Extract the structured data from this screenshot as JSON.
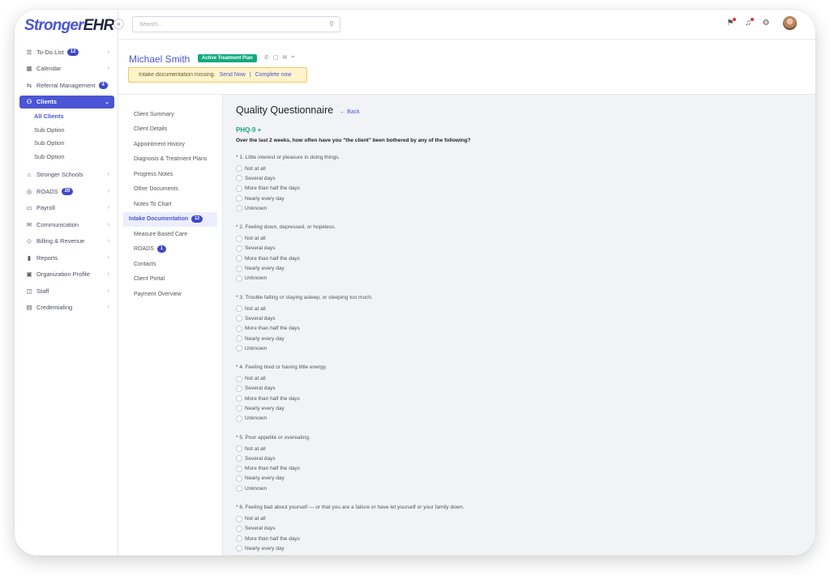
{
  "brand": {
    "part1": "Stronger",
    "part2": "EHR"
  },
  "sidebar": {
    "items": [
      {
        "label": "To-Do List",
        "badge": "12",
        "icon": "list-icon",
        "glyph": "☰"
      },
      {
        "label": "Calendar",
        "icon": "calendar-icon",
        "glyph": "▦"
      },
      {
        "label": "Referral Management",
        "badge": "4",
        "icon": "referral-icon",
        "glyph": "⇆"
      },
      {
        "label": "Clients",
        "icon": "users-icon",
        "glyph": "👥"
      },
      {
        "label": "Stronger Schools",
        "icon": "school-icon",
        "glyph": "⌂"
      },
      {
        "label": "ROADS",
        "badge": "20",
        "icon": "roads-icon",
        "glyph": "◎"
      },
      {
        "label": "Payroll",
        "icon": "payroll-icon",
        "glyph": "▭"
      },
      {
        "label": "Communication",
        "icon": "chat-icon",
        "glyph": "✉"
      },
      {
        "label": "Billing & Revenue",
        "icon": "tag-icon",
        "glyph": "◇"
      },
      {
        "label": "Reports",
        "icon": "chart-icon",
        "glyph": "▮"
      },
      {
        "label": "Organization Profile",
        "icon": "org-icon",
        "glyph": "▣"
      },
      {
        "label": "Staff",
        "icon": "staff-icon",
        "glyph": "◫"
      },
      {
        "label": "Credentialing",
        "icon": "id-card-icon",
        "glyph": "▤"
      }
    ],
    "sub_items": [
      "All Clients",
      "Sub Option",
      "Sub Option",
      "Sub Option"
    ]
  },
  "search": {
    "placeholder": "Search..."
  },
  "client": {
    "name": "Michael Smith",
    "status": "Active Treatment Plan",
    "alert_text": "Intake documentation missing.",
    "alert_send": "Send Now",
    "alert_sep": "|",
    "alert_complete": "Complete now"
  },
  "subnav": {
    "items": [
      {
        "label": "Client Summary"
      },
      {
        "label": "Client Details"
      },
      {
        "label": "Appointment History"
      },
      {
        "label": "Diagnosis & Treatment Plans"
      },
      {
        "label": "Progress Notes"
      },
      {
        "label": "Other Documents"
      },
      {
        "label": "Notes To Chart"
      },
      {
        "label": "Intake Documentation",
        "badge": "12"
      },
      {
        "label": "Measure Based Care"
      },
      {
        "label": "ROADS",
        "badge": "1"
      },
      {
        "label": "Contacts"
      },
      {
        "label": "Client Portal"
      },
      {
        "label": "Payment Overview"
      }
    ]
  },
  "questionnaire": {
    "title": "Quality Questionnaire",
    "back": "Back",
    "section": "PHQ-9 +",
    "instruction": "Over the last 2 weeks, how often have you \"the client\" been bothered by any of the following?",
    "options": [
      "Not at all",
      "Several days",
      "More than half the days",
      "Nearly every day",
      "Unknown"
    ],
    "questions": [
      "* 1. Little interest or pleasure in doing things.",
      "* 2. Feeling down, depressed, or hopeless.",
      "* 3. Trouble falling or staying asleep, or sleeping too much.",
      "* 4. Feeling tired or having little energy.",
      "* 5. Poor appetite or overeating.",
      "* 6. Feeling bad about yourself — or that you are a failure or have let yourself or your family down."
    ]
  }
}
